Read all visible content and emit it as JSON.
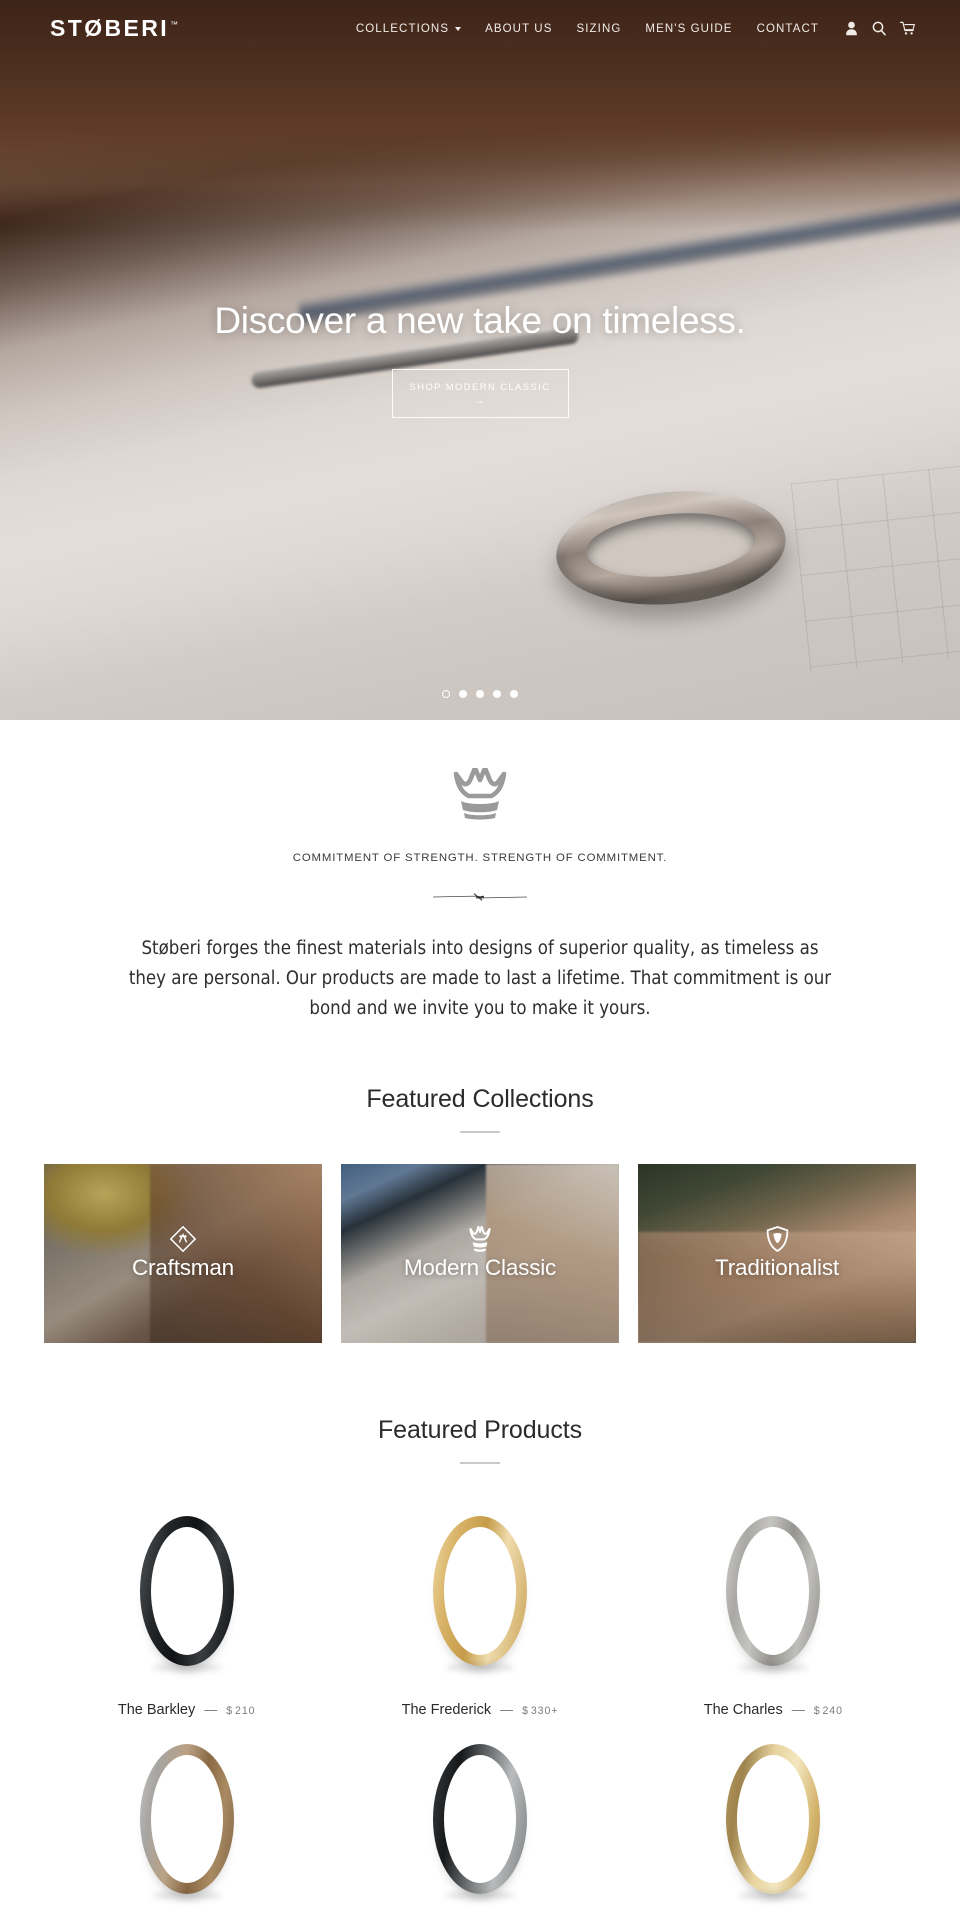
{
  "brand": {
    "name": "STØBERI",
    "tm": "™"
  },
  "nav": {
    "items": [
      {
        "label": "COLLECTIONS",
        "has_dropdown": true
      },
      {
        "label": "ABOUT US",
        "has_dropdown": false
      },
      {
        "label": "SIZING",
        "has_dropdown": false
      },
      {
        "label": "MEN'S GUIDE",
        "has_dropdown": false
      },
      {
        "label": "CONTACT",
        "has_dropdown": false
      }
    ],
    "icons": [
      {
        "name": "account-icon"
      },
      {
        "name": "search-icon"
      },
      {
        "name": "cart-icon"
      }
    ]
  },
  "hero": {
    "title": "Discover a new take on timeless.",
    "cta_label": "SHOP MODERN CLASSIC",
    "cta_arrow": "→",
    "slide_count": 5,
    "active_slide": 1
  },
  "commitment": {
    "icon": "crown-icon",
    "tagline": "COMMITMENT OF STRENGTH. STRENGTH OF COMMITMENT.",
    "ornament": "sword-divider-icon",
    "body": "Støberi forges the finest materials into designs of superior quality, as timeless as they are personal. Our products are made to last a lifetime. That commitment is our bond and we invite you to make it yours."
  },
  "collections": {
    "title": "Featured Collections",
    "cards": [
      {
        "label": "Craftsman",
        "icon": "hammer-badge-icon"
      },
      {
        "label": "Modern Classic",
        "icon": "crown-icon"
      },
      {
        "label": "Traditionalist",
        "icon": "shield-icon"
      }
    ]
  },
  "products": {
    "title": "Featured Products",
    "currency": "$",
    "items": [
      {
        "name": "The Barkley",
        "price": "210",
        "currency": "$",
        "separator": "—",
        "ring": "g-black"
      },
      {
        "name": "The Frederick",
        "price": "330+",
        "currency": "$",
        "separator": "—",
        "ring": "g-gold"
      },
      {
        "name": "The Charles",
        "price": "240",
        "currency": "$",
        "separator": "—",
        "ring": "g-hammer"
      },
      {
        "name": "",
        "price": "",
        "currency": "",
        "separator": "",
        "ring": "g-wood"
      },
      {
        "name": "",
        "price": "",
        "currency": "",
        "separator": "",
        "ring": "g-twotone"
      },
      {
        "name": "",
        "price": "",
        "currency": "",
        "separator": "",
        "ring": "g-gold2"
      }
    ]
  },
  "colors": {
    "header_text": "#f2ece8",
    "hero_brown": "#4a3226",
    "text_dark": "#2b2b2b",
    "text_muted": "#7b7b7b",
    "rule": "#c9c9c9"
  }
}
